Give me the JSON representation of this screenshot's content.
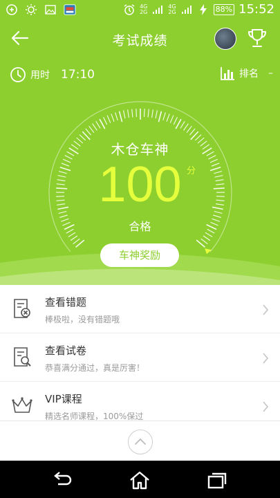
{
  "status_bar": {
    "net_top": "4G",
    "net_bottom": "2G",
    "net_top2": "4G",
    "battery": "88%",
    "time": "15:52"
  },
  "header": {
    "title": "考试成绩"
  },
  "stats": {
    "time_label": "用时",
    "time_value": "17:10",
    "rank_label": "排名",
    "rank_value": "–"
  },
  "result": {
    "title_name": "木仓车神",
    "score": "100",
    "unit": "分",
    "status": "合格",
    "reward_button": "车神奖励",
    "score_fraction": 1.0
  },
  "list": [
    {
      "title": "查看错题",
      "subtitle": "棒极啦，没有错题哦",
      "icon": "wrong-questions-icon"
    },
    {
      "title": "查看试卷",
      "subtitle": "恭喜满分通过，真是厉害！",
      "icon": "review-paper-icon"
    },
    {
      "title": "VIP课程",
      "subtitle": "精选名师课程，100%保过",
      "icon": "crown-icon"
    }
  ],
  "colors": {
    "primary_green": "#8ccf2e",
    "score_yellow": "#e6ff3c"
  }
}
